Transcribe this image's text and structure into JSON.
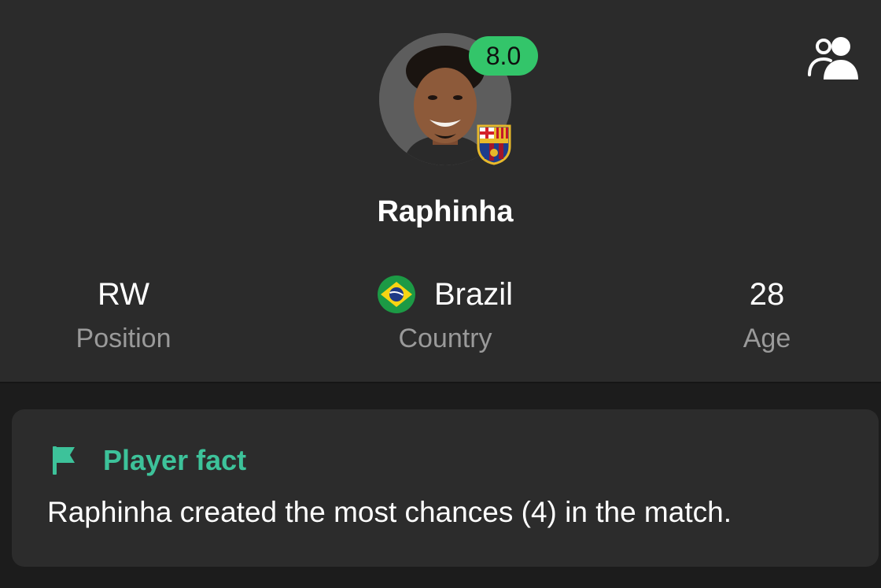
{
  "header": {
    "rating": "8.0",
    "player_name": "Raphinha",
    "colors": {
      "rating_bg": "#33c56a",
      "accent": "#3dc29a"
    },
    "compare_icon": "people-icon"
  },
  "stats": [
    {
      "value": "RW",
      "label": "Position"
    },
    {
      "value": "Brazil",
      "label": "Country",
      "icon": "brazil-flag-icon"
    },
    {
      "value": "28",
      "label": "Age"
    }
  ],
  "fact": {
    "icon": "flag-icon",
    "title": "Player fact",
    "text": "Raphinha created the most chances (4) in the match."
  }
}
